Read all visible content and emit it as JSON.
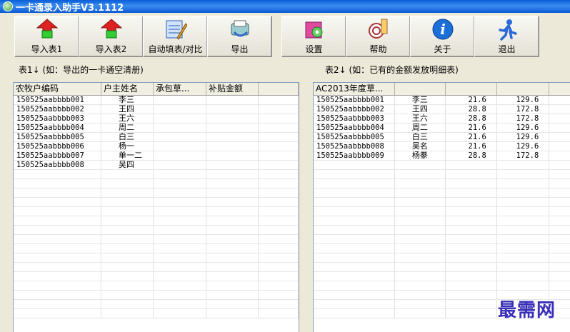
{
  "window": {
    "title": "一卡通录入助手V3.1112"
  },
  "toolbar": [
    {
      "key": "import1",
      "label": "导入表1",
      "icon": "import-icon"
    },
    {
      "key": "import2",
      "label": "导入表2",
      "icon": "import-icon"
    },
    {
      "key": "autofill",
      "label": "自动填表/对比",
      "icon": "autofill-icon"
    },
    {
      "key": "export",
      "label": "导出",
      "icon": "export-icon"
    },
    {
      "key": "settings",
      "label": "设置",
      "icon": "settings-icon"
    },
    {
      "key": "help",
      "label": "帮助",
      "icon": "help-icon"
    },
    {
      "key": "about",
      "label": "关于",
      "icon": "info-icon"
    },
    {
      "key": "exit",
      "label": "退出",
      "icon": "exit-icon"
    }
  ],
  "table1": {
    "caption": "表1↓  (如：导出的一卡通空清册)",
    "columns": [
      "农牧户编码",
      "户主姓名",
      "承包草...",
      "补贴金额",
      ""
    ],
    "rows": [
      [
        "150525aabbbb001",
        "李三",
        "",
        ""
      ],
      [
        "150525aabbbb002",
        "王四",
        "",
        ""
      ],
      [
        "150525aabbbb003",
        "王六",
        "",
        ""
      ],
      [
        "150525aabbbb004",
        "周二",
        "",
        ""
      ],
      [
        "150525aabbbb005",
        "白三",
        "",
        ""
      ],
      [
        "150525aabbbb006",
        "杨一",
        "",
        ""
      ],
      [
        "150525aabbbb007",
        "单一二",
        "",
        ""
      ],
      [
        "150525aabbbb008",
        "吴四",
        "",
        ""
      ]
    ]
  },
  "table2": {
    "caption": "表2↓  (如：已有的金额发放明细表)",
    "columns": [
      "AC2013年度草...",
      "",
      "",
      "",
      ""
    ],
    "rows": [
      [
        "150525aabbbb001",
        "李三",
        "21.6",
        "129.6"
      ],
      [
        "150525aabbbb002",
        "王四",
        "28.8",
        "172.8"
      ],
      [
        "150525aabbbb003",
        "王六",
        "28.8",
        "172.8"
      ],
      [
        "150525aabbbb004",
        "周二",
        "21.6",
        "129.6"
      ],
      [
        "150525aabbbb005",
        "白三",
        "21.6",
        "129.6"
      ],
      [
        "150525aabbbb008",
        "吴名",
        "21.6",
        "129.6"
      ],
      [
        "150525aabbbb009",
        "杨豢",
        "28.8",
        "172.8"
      ]
    ]
  },
  "watermark": "最需网",
  "colors": {
    "titlebar": "#0a5ed6",
    "window_bg": "#ece9d8",
    "grid_border": "#7f9db9"
  }
}
